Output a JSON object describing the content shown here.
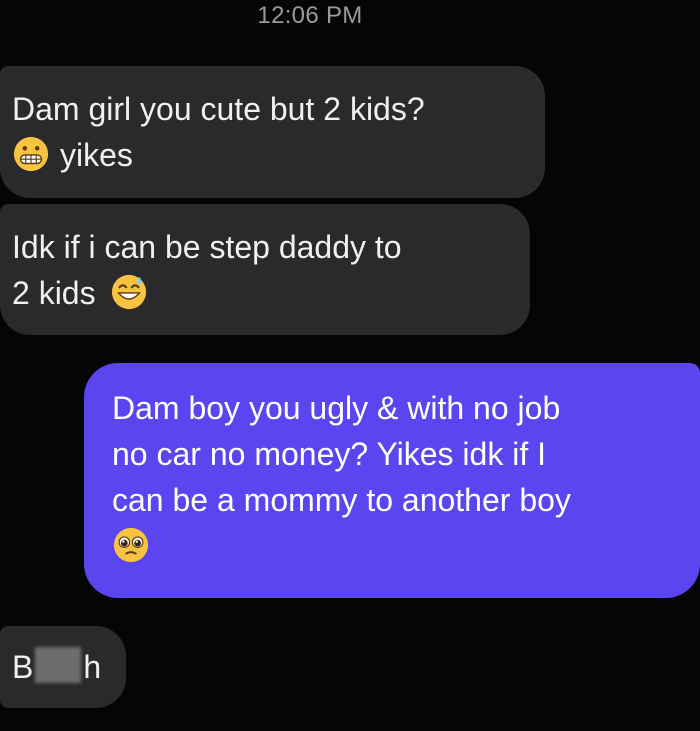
{
  "status_bar": {
    "time": "12:06 PM"
  },
  "messages": [
    {
      "direction": "incoming",
      "line1": "Dam girl you cute but 2 kids?",
      "line2": "yikes",
      "emoji": "grimacing-face-icon"
    },
    {
      "direction": "incoming",
      "line1": "Idk if i can be step daddy to",
      "line2": "2 kids",
      "emoji": "grinning-face-with-sweat-icon"
    },
    {
      "direction": "outgoing",
      "line1": "Dam boy you ugly & with no job",
      "line2": "no car no money? Yikes idk if I",
      "line3": "can be a mommy to another boy",
      "emoji": "pleading-face-icon"
    },
    {
      "direction": "incoming",
      "prefix": "B",
      "suffix": "h",
      "censored": true
    }
  ],
  "colors": {
    "background": "#050505",
    "incoming_bubble": "#2a2a2c",
    "outgoing_bubble": "#5b45f1",
    "timestamp": "#9a9a9a"
  }
}
